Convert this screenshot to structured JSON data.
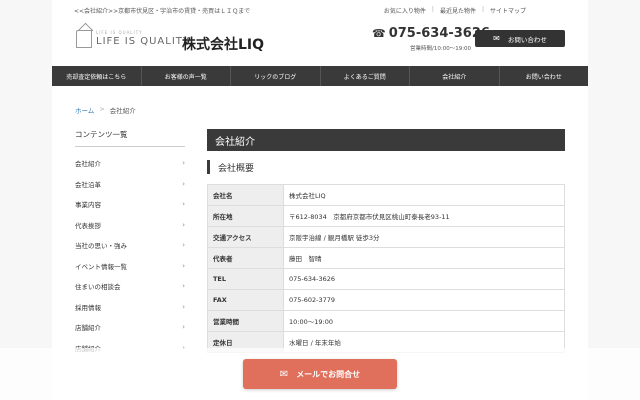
{
  "header": {
    "tagline": "<<会社紹介>>京都市伏見区・宇治市の賃貸・売買はＬＩＱまで",
    "top_links": [
      "お気に入り物件",
      "最近見た物件",
      "サイトマップ"
    ],
    "logo_small": "LIFE IS QUALITY",
    "logo_text": "LIFE IS QUALITY",
    "company_name": "株式会社LIQ",
    "phone": "075-634-3626",
    "hours": "営業時間/10:00〜19:00",
    "contact_button": "お問い合わせ"
  },
  "nav": {
    "items": [
      "売却査定依頼はこちら",
      "お客様の声一覧",
      "リックのブログ",
      "よくあるご質問",
      "会社紹介",
      "お問い合わせ"
    ]
  },
  "breadcrumb": {
    "home": "ホーム",
    "separator": ">",
    "current": "会社紹介"
  },
  "sidebar": {
    "title": "コンテンツ一覧",
    "items": [
      "会社紹介",
      "会社沿革",
      "事業内容",
      "代表挨拶",
      "当社の思い・強み",
      "イベント情報一覧",
      "住まいの相談会",
      "採用情報",
      "店舗紹介",
      "店舗紹介"
    ]
  },
  "main": {
    "section_title": "会社紹介",
    "subtitle": "会社概要",
    "rows": [
      {
        "label": "会社名",
        "value": "株式会社LIQ"
      },
      {
        "label": "所在地",
        "value": "〒612-8034　京都府京都市伏見区桃山町泰長老93-11"
      },
      {
        "label": "交通アクセス",
        "value": "京阪宇治線 / 観月橋駅 徒歩3分"
      },
      {
        "label": "代表者",
        "value": "藤田　智晴"
      },
      {
        "label": "TEL",
        "value": "075-634-3626"
      },
      {
        "label": "FAX",
        "value": "075-602-3779"
      },
      {
        "label": "営業時間",
        "value": "10:00〜19:00"
      },
      {
        "label": "定休日",
        "value": "水曜日 / 年末年始"
      }
    ]
  },
  "cta": {
    "label": "メールでお問合せ"
  },
  "colors": {
    "nav_bg": "#3a3a3a",
    "cta_bg": "#e06f5c",
    "link": "#3479b6"
  }
}
